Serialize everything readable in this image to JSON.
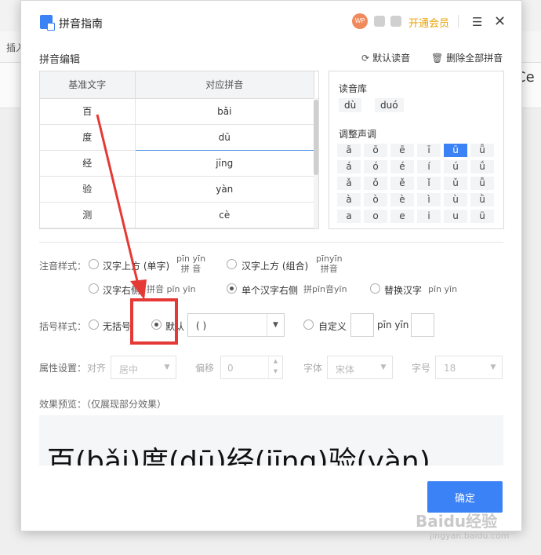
{
  "background": {
    "menu_insert": "插入",
    "ribbon_right": "Ce"
  },
  "dialog": {
    "title": "拼音指南",
    "wps_badge": "WP",
    "vip_label": "开通会员",
    "menu_icon": "hamburger-icon",
    "close_icon": "close-icon"
  },
  "edit": {
    "section_label": "拼音编辑",
    "default_reading": "默认读音",
    "delete_all": "删除全部拼音",
    "headers": [
      "基准文字",
      "对应拼音"
    ],
    "rows": [
      {
        "base": "百",
        "pinyin": "bǎi"
      },
      {
        "base": "度",
        "pinyin": "dū"
      },
      {
        "base": "经",
        "pinyin": "jīng"
      },
      {
        "base": "验",
        "pinyin": "yàn"
      },
      {
        "base": "测",
        "pinyin": "cè"
      }
    ],
    "active_row": 1
  },
  "library": {
    "label": "读音库",
    "readings": [
      "dù",
      "duó"
    ],
    "tone_label": "调整声调",
    "tones": [
      [
        "ā",
        "ō",
        "ē",
        "ī",
        "ū",
        "ǖ"
      ],
      [
        "á",
        "ó",
        "é",
        "í",
        "ú",
        "ǘ"
      ],
      [
        "ǎ",
        "ǒ",
        "ě",
        "ǐ",
        "ǔ",
        "ǚ"
      ],
      [
        "à",
        "ò",
        "è",
        "ì",
        "ù",
        "ǜ"
      ],
      [
        "a",
        "o",
        "e",
        "i",
        "u",
        "ü"
      ]
    ],
    "selected_tone": "ū"
  },
  "annotation": {
    "label": "注音样式：",
    "options": [
      {
        "text": "汉字上方 (单字)",
        "sample_top": "pīn yīn",
        "sample_bottom": "拼 音",
        "checked": false
      },
      {
        "text": "汉字上方 (组合)",
        "sample_top": "pīnyīn",
        "sample_bottom": "拼音",
        "checked": false
      },
      {
        "text": "汉字右侧",
        "sample": "拼音 pīn yīn",
        "checked": false
      },
      {
        "text": "单个汉字右侧",
        "sample": "拼pīn音yīn",
        "checked": true
      },
      {
        "text": "替换汉字",
        "sample": "pīn yīn",
        "checked": false
      }
    ]
  },
  "bracket": {
    "label": "括号样式：",
    "none": "无括号",
    "default": "默认",
    "default_value": "( )",
    "custom": "自定义",
    "custom_sample": "pīn yīn",
    "selected": "default"
  },
  "props": {
    "label": "属性设置：",
    "align_label": "对齐",
    "align_value": "居中",
    "offset_label": "偏移",
    "offset_value": "0",
    "font_label": "字体",
    "font_value": "宋体",
    "size_label": "字号",
    "size_value": "18"
  },
  "preview": {
    "label": "效果预览：（仅展现部分效果）",
    "text": "百(bǎi)度(dū)经(jīng)验(yàn)"
  },
  "confirm_label": "确定",
  "watermark": {
    "main": "Baidu经验",
    "sub": "jingyan.baidu.com"
  }
}
